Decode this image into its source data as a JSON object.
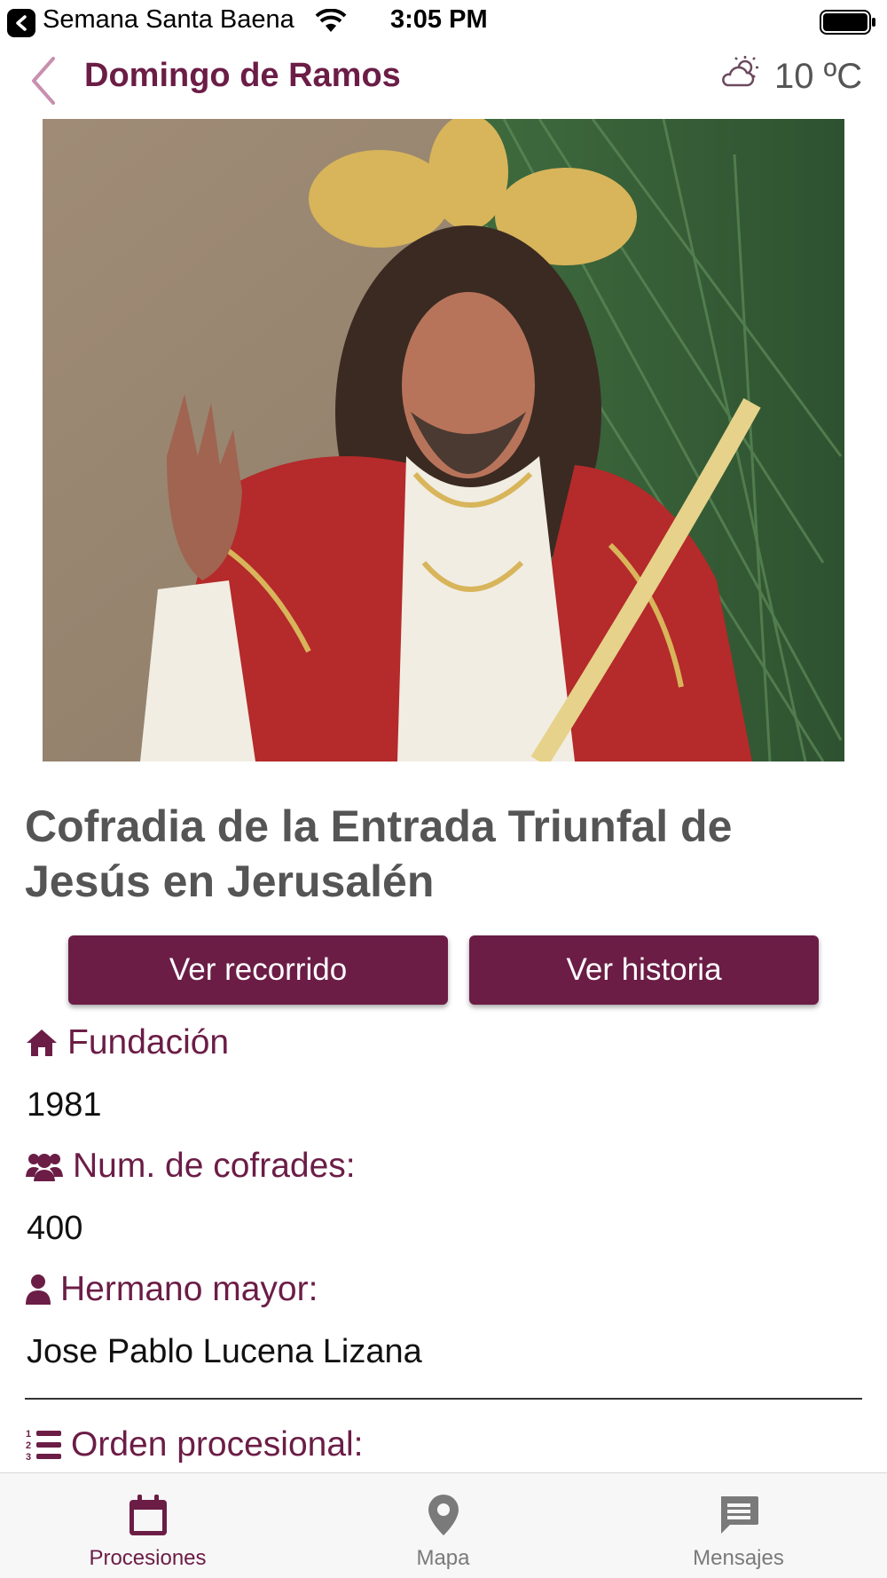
{
  "status_bar": {
    "back_app": "Semana Santa Baena",
    "time": "3:05 PM"
  },
  "nav": {
    "title": "Domingo de Ramos",
    "weather_icon": "partly-cloudy-icon",
    "temperature": "10 ºC"
  },
  "hero": {
    "alt_icon": "statue-photo"
  },
  "brotherhood": {
    "name": "Cofradia de la Entrada Triunfal de Jesús en Jerusalén"
  },
  "buttons": {
    "route_label": "Ver recorrido",
    "history_label": "Ver historia"
  },
  "info": {
    "foundation_label": "Fundación",
    "foundation_value": "1981",
    "members_label": "Num. de cofrades:",
    "members_value": "400",
    "head_label": "Hermano mayor:",
    "head_value": "Jose Pablo Lucena Lizana",
    "order_label": "Orden procesional:"
  },
  "tabs": [
    {
      "label": "Procesiones",
      "icon": "calendar-icon",
      "active": true
    },
    {
      "label": "Mapa",
      "icon": "map-pin-icon",
      "active": false
    },
    {
      "label": "Mensajes",
      "icon": "message-icon",
      "active": false
    }
  ],
  "colors": {
    "accent": "#6b1d46",
    "inactive": "#7a7a7a"
  }
}
